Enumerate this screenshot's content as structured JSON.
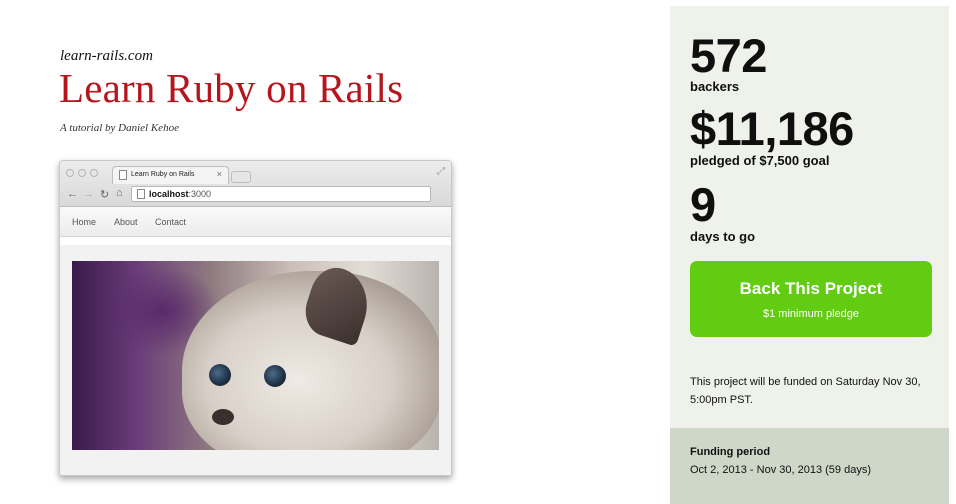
{
  "promo": {
    "site_url": "learn-rails.com",
    "title": "Learn Ruby on Rails",
    "byline": "A tutorial by Daniel Kehoe",
    "browser": {
      "tab_title": "Learn Ruby on Rails",
      "tab_close": "×",
      "url_host": "localhost",
      "url_port": ":3000",
      "nav_items": [
        "Home",
        "About",
        "Contact"
      ]
    }
  },
  "stats": {
    "backers": {
      "value": "572",
      "label": "backers"
    },
    "pledged": {
      "value": "$11,186",
      "label": "pledged of $7,500 goal"
    },
    "days": {
      "value": "9",
      "label": "days to go"
    }
  },
  "cta": {
    "label": "Back This Project",
    "sublabel": "$1 minimum pledge",
    "color": "#62cc12"
  },
  "funded_note": "This project will be funded on Saturday Nov 30, 5:00pm PST.",
  "funding_period": {
    "title": "Funding period",
    "dates": "Oct 2, 2013 - Nov 30, 2013 (59 days)"
  },
  "icons": [
    "back-arrow-icon",
    "forward-arrow-icon",
    "reload-icon",
    "home-icon",
    "page-icon",
    "expand-icon"
  ]
}
